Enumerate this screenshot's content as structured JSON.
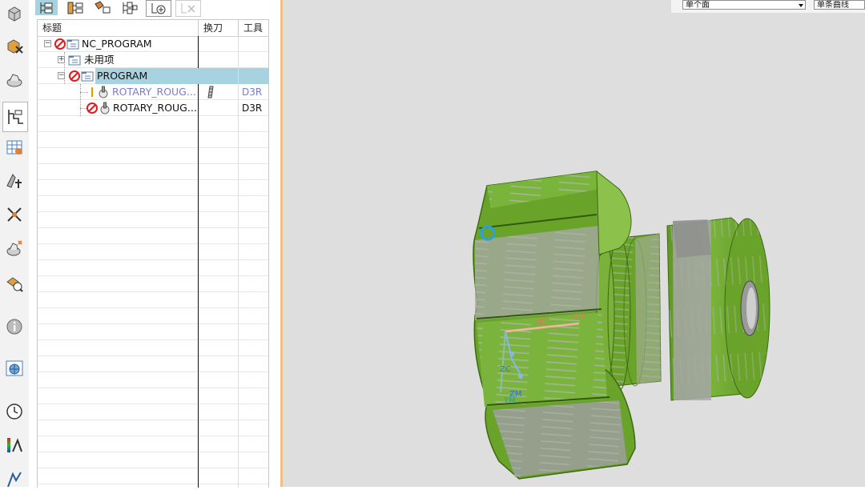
{
  "navigator": {
    "columns": [
      "标题",
      "换刀",
      "工具"
    ],
    "rows": [
      {
        "label": "NC_PROGRAM",
        "level": 0,
        "expander": "−",
        "status": "error",
        "folder": true
      },
      {
        "label": "未用项",
        "level": 1,
        "expander": "+",
        "status": "",
        "folder": true
      },
      {
        "label": "PROGRAM",
        "level": 1,
        "expander": "−",
        "status": "error",
        "folder": true,
        "selected": true
      },
      {
        "label": "ROTARY_ROUG...",
        "level": 2,
        "status": "warning",
        "tool": "D3R",
        "toolchange": true,
        "style": "dim"
      },
      {
        "label": "ROTARY_ROUG...",
        "level": 2,
        "status": "error",
        "tool": "D3R"
      }
    ]
  },
  "selection_bar": {
    "filter_value": "单个面",
    "curve_rule_value": "单条曲线"
  },
  "viewport": {
    "triad_labels": [
      "XC",
      "XM",
      "ZC",
      "ZM",
      "YM"
    ],
    "part_color": "#6aa32a",
    "background_color": "#dedede"
  },
  "colors": {
    "selection": "#a7d3e0",
    "error": "#d81e1e",
    "warning": "#e0a000",
    "dim_text": "#7a7ad0",
    "panel_divider": "#f0c080"
  }
}
